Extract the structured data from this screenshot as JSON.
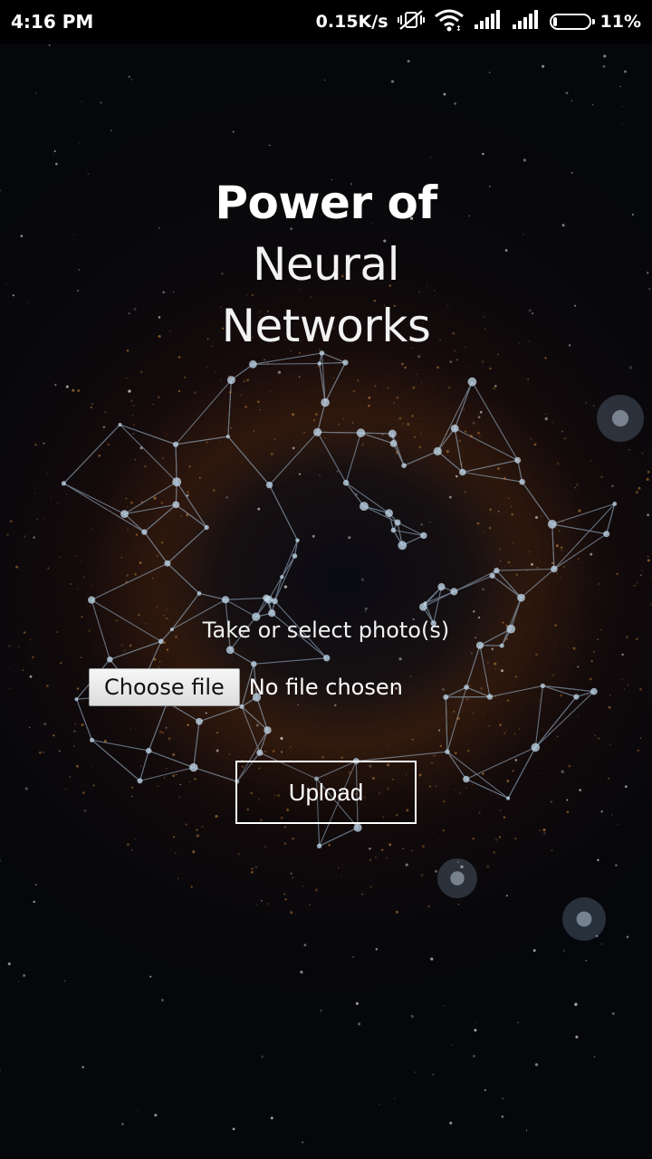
{
  "status_bar": {
    "time": "4:16 PM",
    "net_speed": "0.15K/s",
    "battery_level": 11,
    "battery_percent": "11%",
    "icons": [
      "mute-vibrate-icon",
      "wifi-icon",
      "signal-icon",
      "signal-icon"
    ]
  },
  "headline": {
    "line1": "Power of",
    "line2": "Neural",
    "line3": "Networks"
  },
  "form": {
    "prompt": "Take or select photo(s)",
    "choose_label": "Choose file",
    "no_file_text": "No file chosen",
    "upload_label": "Upload"
  },
  "colors": {
    "text": "#ffffff",
    "nebula": "#7a4616",
    "network_lines": "#a9c6e0"
  }
}
